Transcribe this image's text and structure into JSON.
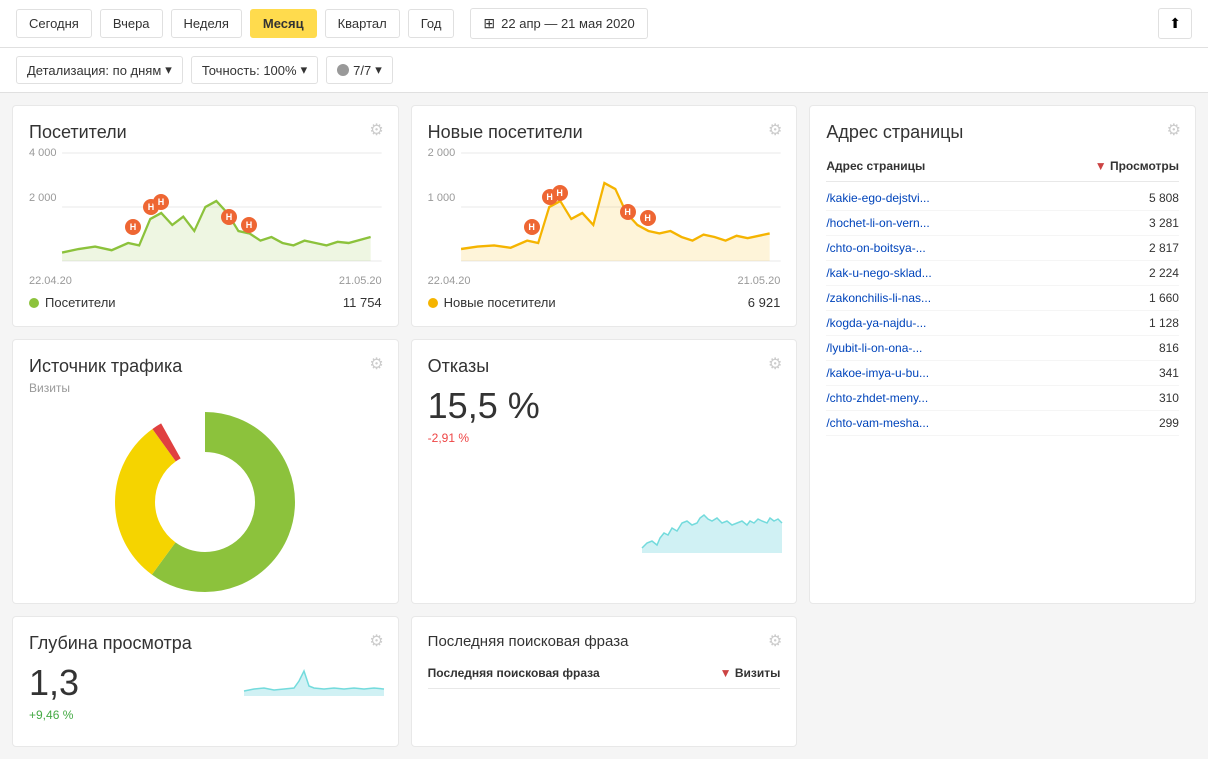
{
  "topbar": {
    "periods": [
      "Сегодня",
      "Вчера",
      "Неделя",
      "Месяц",
      "Квартал",
      "Год"
    ],
    "active_period": "Месяц",
    "date_range": "22 апр — 21 мая 2020",
    "export_icon": "↑"
  },
  "filterbar": {
    "detail_label": "Детализация: по дням",
    "accuracy_label": "Точность: 100%",
    "robots_label": "7/7"
  },
  "visitors_card": {
    "title": "Посетители",
    "y_top": "4 000",
    "y_mid": "2 000",
    "date_start": "22.04.20",
    "date_end": "21.05.20",
    "legend_label": "Посетители",
    "legend_value": "11 754",
    "color": "#8cc23c"
  },
  "new_visitors_card": {
    "title": "Новые посетители",
    "y_top": "2 000",
    "y_mid": "1 000",
    "date_start": "22.04.20",
    "date_end": "21.05.20",
    "legend_label": "Новые посетители",
    "legend_value": "6 921",
    "color": "#f5b400"
  },
  "address_card": {
    "title": "Адрес страницы",
    "col1": "Адрес страницы",
    "col2": "Просмотры",
    "rows": [
      {
        "url": "/kakie-ego-dejstvi...",
        "value": "5 808"
      },
      {
        "url": "/hochet-li-on-vern...",
        "value": "3 281"
      },
      {
        "url": "/chto-on-boitsya-...",
        "value": "2 817"
      },
      {
        "url": "/kak-u-nego-sklad...",
        "value": "2 224"
      },
      {
        "url": "/zakonchilis-li-nas...",
        "value": "1 660"
      },
      {
        "url": "/kogda-ya-najdu-...",
        "value": "1 128"
      },
      {
        "url": "/lyubit-li-on-ona-...",
        "value": "816"
      },
      {
        "url": "/kakoe-imya-u-bu...",
        "value": "341"
      },
      {
        "url": "/chto-zhdet-meny...",
        "value": "310"
      },
      {
        "url": "/chto-vam-mesha...",
        "value": "299"
      }
    ]
  },
  "traffic_card": {
    "title": "Источник трафика",
    "subtitle": "Визиты"
  },
  "bounce_card": {
    "title": "Отказы",
    "value": "15,5 %",
    "change": "-2,91 %",
    "change_type": "negative"
  },
  "depth_card": {
    "title": "Глубина просмотра",
    "value": "1,3",
    "change": "+9,46 %",
    "change_type": "positive"
  },
  "last_search_card": {
    "title": "Последняя поисковая фраза",
    "col1": "Последняя поисковая фраза",
    "col2": "Визиты"
  }
}
